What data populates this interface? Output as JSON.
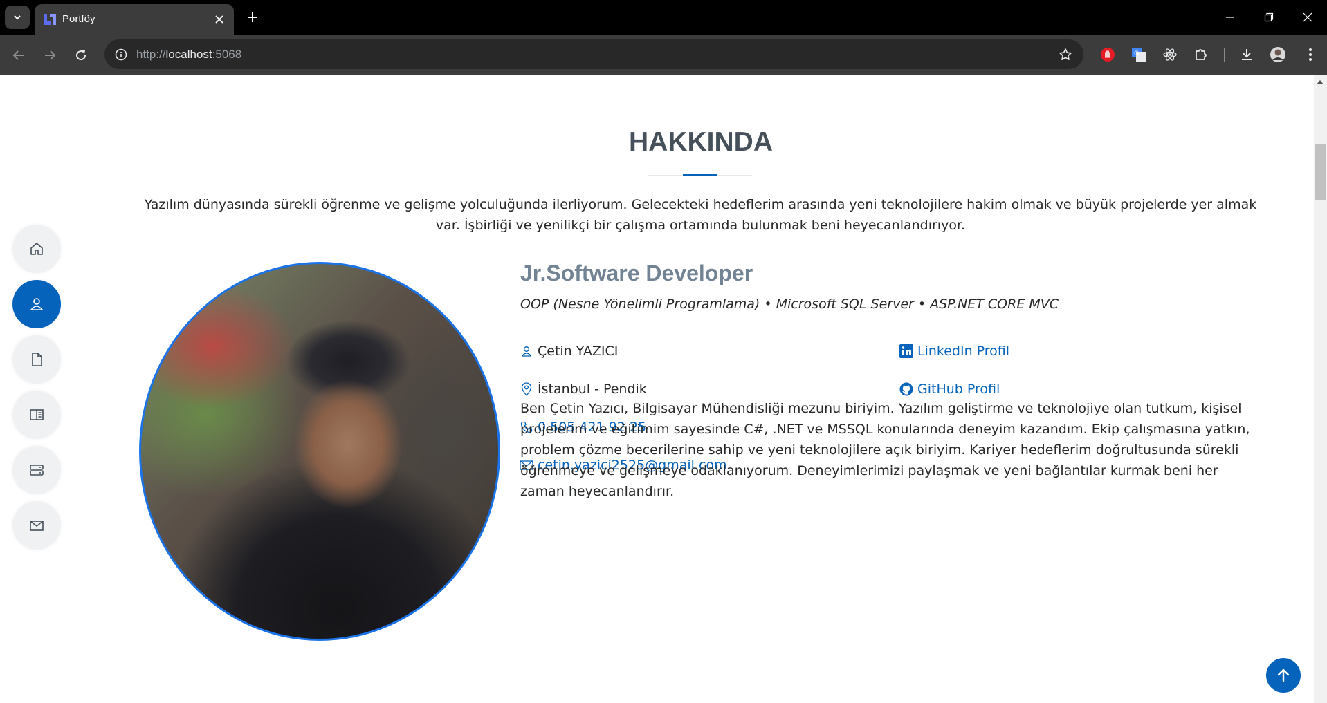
{
  "browser": {
    "tab_title": "Portföy",
    "url_scheme": "http://",
    "url_host": "localhost",
    "url_port": ":5068"
  },
  "page": {
    "section_title": "HAKKINDA",
    "intro": "Yazılım dünyasında sürekli öğrenme ve gelişme yolculuğunda ilerliyorum. Gelecekteki hedeflerim arasında yeni teknolojilere hakim olmak ve büyük projelerde yer almak var. İşbirliği ve yenilikçi bir çalışma ortamında bulunmak beni heyecanlandırıyor.",
    "role": "Jr.Software Developer",
    "skills": "OOP (Nesne Yönelimli Programlama) • Microsoft SQL Server • ASP.NET CORE MVC",
    "name": "Çetin YAZICI",
    "location": "İstanbul - Pendik",
    "phone": "0 505 421 92 25",
    "email": "cetin.yazici2525@gmail.com",
    "linkedin": "LinkedIn Profil",
    "github": "GitHub Profil",
    "bio": "Ben Çetin Yazıcı, Bilgisayar Mühendisliği mezunu biriyim. Yazılım geliştirme ve teknolojiye olan tutkum, kişisel projelerim ve eğitimim sayesinde C#, .NET ve MSSQL konularında deneyim kazandım. Ekip çalışmasına yatkın, problem çözme becerilerine sahip ve yeni teknolojilere açık biriyim. Kariyer hedeflerim doğrultusunda sürekli öğrenmeye ve gelişmeye odaklanıyorum. Deneyimlerimizi paylaşmak ve yeni bağlantılar kurmak beni her zaman heyecanlandırır."
  },
  "sidenav": [
    {
      "icon": "home-icon",
      "active": false
    },
    {
      "icon": "person-icon",
      "active": true
    },
    {
      "icon": "file-icon",
      "active": false
    },
    {
      "icon": "book-icon",
      "active": false
    },
    {
      "icon": "server-icon",
      "active": false
    },
    {
      "icon": "envelope-icon",
      "active": false
    }
  ],
  "colors": {
    "accent": "#0563bb",
    "heading": "#45505b",
    "role": "#728394",
    "text": "#272829"
  }
}
